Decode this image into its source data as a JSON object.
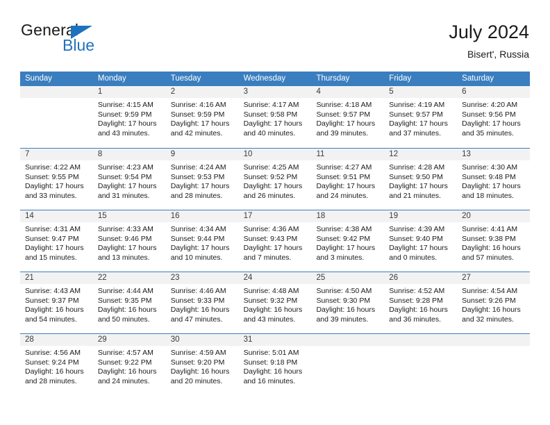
{
  "brand": {
    "name_top": "General",
    "name_bottom": "Blue",
    "accent_color": "#1e72bd"
  },
  "header": {
    "title": "July 2024",
    "subtitle": "Bisert', Russia"
  },
  "calendar": {
    "header_bg": "#3a7ebf",
    "header_text_color": "#ffffff",
    "daynum_band_bg": "#f2f2f2",
    "weekdays": [
      "Sunday",
      "Monday",
      "Tuesday",
      "Wednesday",
      "Thursday",
      "Friday",
      "Saturday"
    ],
    "weeks": [
      [
        {
          "day": "",
          "lines": []
        },
        {
          "day": "1",
          "lines": [
            "Sunrise: 4:15 AM",
            "Sunset: 9:59 PM",
            "Daylight: 17 hours",
            "and 43 minutes."
          ]
        },
        {
          "day": "2",
          "lines": [
            "Sunrise: 4:16 AM",
            "Sunset: 9:59 PM",
            "Daylight: 17 hours",
            "and 42 minutes."
          ]
        },
        {
          "day": "3",
          "lines": [
            "Sunrise: 4:17 AM",
            "Sunset: 9:58 PM",
            "Daylight: 17 hours",
            "and 40 minutes."
          ]
        },
        {
          "day": "4",
          "lines": [
            "Sunrise: 4:18 AM",
            "Sunset: 9:57 PM",
            "Daylight: 17 hours",
            "and 39 minutes."
          ]
        },
        {
          "day": "5",
          "lines": [
            "Sunrise: 4:19 AM",
            "Sunset: 9:57 PM",
            "Daylight: 17 hours",
            "and 37 minutes."
          ]
        },
        {
          "day": "6",
          "lines": [
            "Sunrise: 4:20 AM",
            "Sunset: 9:56 PM",
            "Daylight: 17 hours",
            "and 35 minutes."
          ]
        }
      ],
      [
        {
          "day": "7",
          "lines": [
            "Sunrise: 4:22 AM",
            "Sunset: 9:55 PM",
            "Daylight: 17 hours",
            "and 33 minutes."
          ]
        },
        {
          "day": "8",
          "lines": [
            "Sunrise: 4:23 AM",
            "Sunset: 9:54 PM",
            "Daylight: 17 hours",
            "and 31 minutes."
          ]
        },
        {
          "day": "9",
          "lines": [
            "Sunrise: 4:24 AM",
            "Sunset: 9:53 PM",
            "Daylight: 17 hours",
            "and 28 minutes."
          ]
        },
        {
          "day": "10",
          "lines": [
            "Sunrise: 4:25 AM",
            "Sunset: 9:52 PM",
            "Daylight: 17 hours",
            "and 26 minutes."
          ]
        },
        {
          "day": "11",
          "lines": [
            "Sunrise: 4:27 AM",
            "Sunset: 9:51 PM",
            "Daylight: 17 hours",
            "and 24 minutes."
          ]
        },
        {
          "day": "12",
          "lines": [
            "Sunrise: 4:28 AM",
            "Sunset: 9:50 PM",
            "Daylight: 17 hours",
            "and 21 minutes."
          ]
        },
        {
          "day": "13",
          "lines": [
            "Sunrise: 4:30 AM",
            "Sunset: 9:48 PM",
            "Daylight: 17 hours",
            "and 18 minutes."
          ]
        }
      ],
      [
        {
          "day": "14",
          "lines": [
            "Sunrise: 4:31 AM",
            "Sunset: 9:47 PM",
            "Daylight: 17 hours",
            "and 15 minutes."
          ]
        },
        {
          "day": "15",
          "lines": [
            "Sunrise: 4:33 AM",
            "Sunset: 9:46 PM",
            "Daylight: 17 hours",
            "and 13 minutes."
          ]
        },
        {
          "day": "16",
          "lines": [
            "Sunrise: 4:34 AM",
            "Sunset: 9:44 PM",
            "Daylight: 17 hours",
            "and 10 minutes."
          ]
        },
        {
          "day": "17",
          "lines": [
            "Sunrise: 4:36 AM",
            "Sunset: 9:43 PM",
            "Daylight: 17 hours",
            "and 7 minutes."
          ]
        },
        {
          "day": "18",
          "lines": [
            "Sunrise: 4:38 AM",
            "Sunset: 9:42 PM",
            "Daylight: 17 hours",
            "and 3 minutes."
          ]
        },
        {
          "day": "19",
          "lines": [
            "Sunrise: 4:39 AM",
            "Sunset: 9:40 PM",
            "Daylight: 17 hours",
            "and 0 minutes."
          ]
        },
        {
          "day": "20",
          "lines": [
            "Sunrise: 4:41 AM",
            "Sunset: 9:38 PM",
            "Daylight: 16 hours",
            "and 57 minutes."
          ]
        }
      ],
      [
        {
          "day": "21",
          "lines": [
            "Sunrise: 4:43 AM",
            "Sunset: 9:37 PM",
            "Daylight: 16 hours",
            "and 54 minutes."
          ]
        },
        {
          "day": "22",
          "lines": [
            "Sunrise: 4:44 AM",
            "Sunset: 9:35 PM",
            "Daylight: 16 hours",
            "and 50 minutes."
          ]
        },
        {
          "day": "23",
          "lines": [
            "Sunrise: 4:46 AM",
            "Sunset: 9:33 PM",
            "Daylight: 16 hours",
            "and 47 minutes."
          ]
        },
        {
          "day": "24",
          "lines": [
            "Sunrise: 4:48 AM",
            "Sunset: 9:32 PM",
            "Daylight: 16 hours",
            "and 43 minutes."
          ]
        },
        {
          "day": "25",
          "lines": [
            "Sunrise: 4:50 AM",
            "Sunset: 9:30 PM",
            "Daylight: 16 hours",
            "and 39 minutes."
          ]
        },
        {
          "day": "26",
          "lines": [
            "Sunrise: 4:52 AM",
            "Sunset: 9:28 PM",
            "Daylight: 16 hours",
            "and 36 minutes."
          ]
        },
        {
          "day": "27",
          "lines": [
            "Sunrise: 4:54 AM",
            "Sunset: 9:26 PM",
            "Daylight: 16 hours",
            "and 32 minutes."
          ]
        }
      ],
      [
        {
          "day": "28",
          "lines": [
            "Sunrise: 4:56 AM",
            "Sunset: 9:24 PM",
            "Daylight: 16 hours",
            "and 28 minutes."
          ]
        },
        {
          "day": "29",
          "lines": [
            "Sunrise: 4:57 AM",
            "Sunset: 9:22 PM",
            "Daylight: 16 hours",
            "and 24 minutes."
          ]
        },
        {
          "day": "30",
          "lines": [
            "Sunrise: 4:59 AM",
            "Sunset: 9:20 PM",
            "Daylight: 16 hours",
            "and 20 minutes."
          ]
        },
        {
          "day": "31",
          "lines": [
            "Sunrise: 5:01 AM",
            "Sunset: 9:18 PM",
            "Daylight: 16 hours",
            "and 16 minutes."
          ]
        },
        {
          "day": "",
          "lines": []
        },
        {
          "day": "",
          "lines": []
        },
        {
          "day": "",
          "lines": []
        }
      ]
    ]
  }
}
